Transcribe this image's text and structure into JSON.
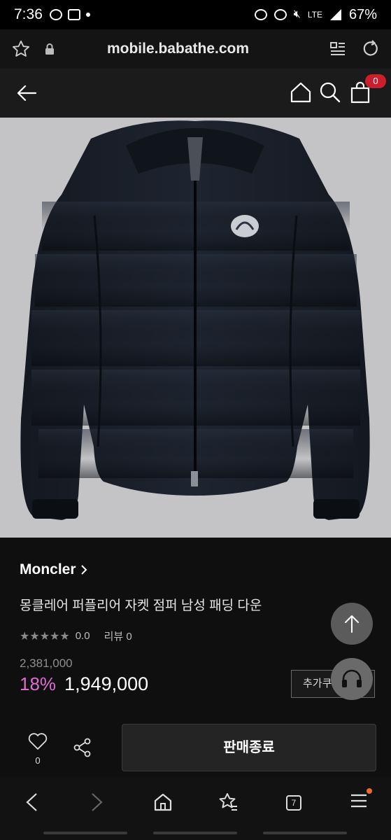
{
  "statusbar": {
    "time": "7:36",
    "network": "LTE",
    "battery": "67%"
  },
  "browser": {
    "url": "mobile.babathe.com",
    "tabs_count": "7"
  },
  "header": {
    "cart_count": "0"
  },
  "product": {
    "brand": "Moncler",
    "title": "몽클레어 퍼플리어 자켓 점퍼 남성 패딩 다운",
    "stars": "★★★★★",
    "rating": "0.0",
    "review_label": "리뷰",
    "review_count": "0",
    "original_price": "2,381,000",
    "discount": "18%",
    "price": "1,949,000",
    "coupon_label": "추가쿠폰"
  },
  "actions": {
    "like_count": "0",
    "soldout_label": "판매종료"
  },
  "colors": {
    "accent": "#e06ad3",
    "badge": "#cc1f2d",
    "background": "#0f0f0f"
  }
}
